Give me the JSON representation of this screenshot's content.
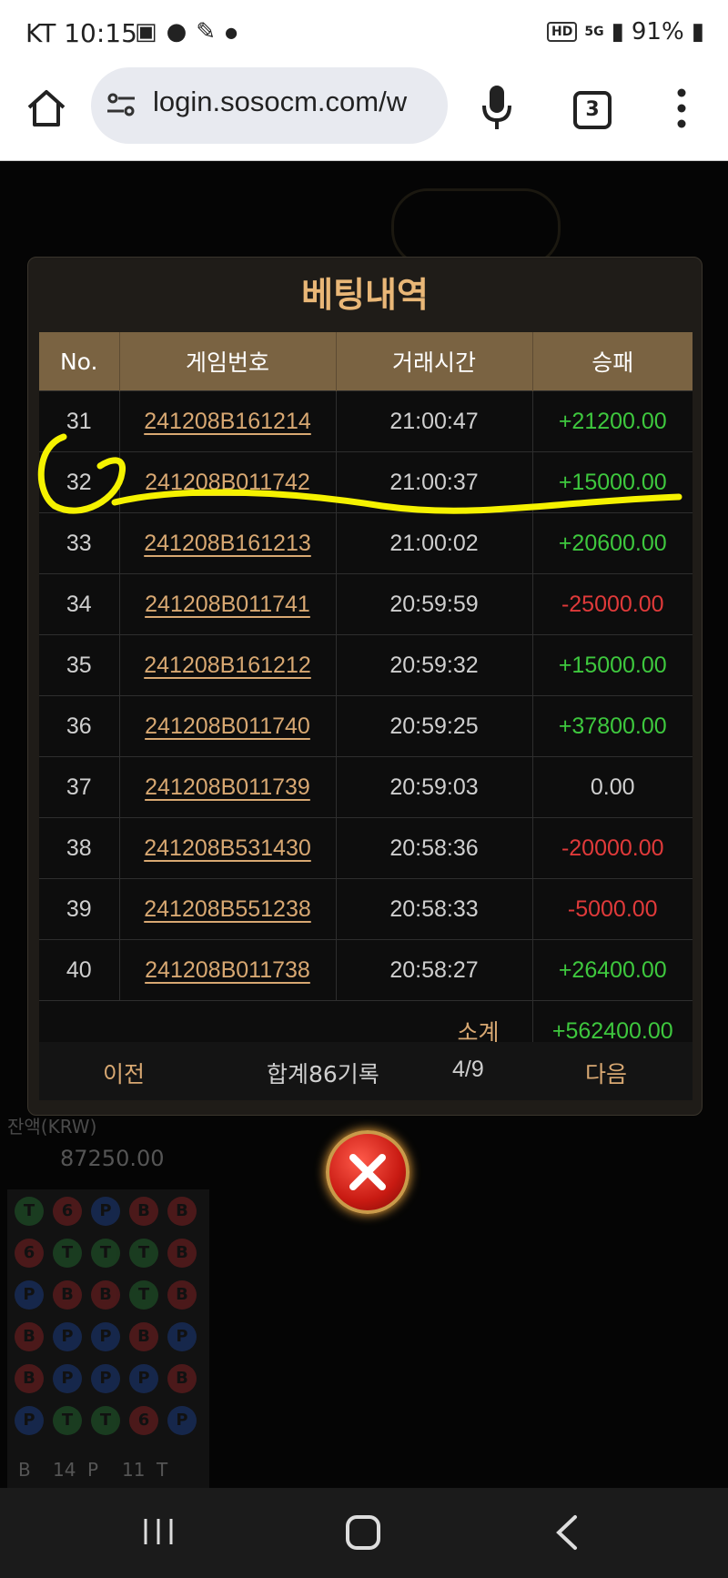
{
  "status_bar": {
    "carrier_time": "KT 10:15",
    "network": "5G",
    "battery": "91%"
  },
  "browser": {
    "url": "login.sosocm.com/w",
    "tab_count": "3"
  },
  "modal": {
    "title": "베팅내역",
    "columns": [
      "No.",
      "게임번호",
      "거래시간",
      "승패"
    ],
    "rows": [
      {
        "no": "31",
        "game": "241208B161214",
        "time": "21:00:47",
        "result": "+21200.00",
        "sign": "pos"
      },
      {
        "no": "32",
        "game": "241208B011742",
        "time": "21:00:37",
        "result": "+15000.00",
        "sign": "pos"
      },
      {
        "no": "33",
        "game": "241208B161213",
        "time": "21:00:02",
        "result": "+20600.00",
        "sign": "pos"
      },
      {
        "no": "34",
        "game": "241208B011741",
        "time": "20:59:59",
        "result": "-25000.00",
        "sign": "neg"
      },
      {
        "no": "35",
        "game": "241208B161212",
        "time": "20:59:32",
        "result": "+15000.00",
        "sign": "pos"
      },
      {
        "no": "36",
        "game": "241208B011740",
        "time": "20:59:25",
        "result": "+37800.00",
        "sign": "pos"
      },
      {
        "no": "37",
        "game": "241208B011739",
        "time": "20:59:03",
        "result": "0.00",
        "sign": "zero"
      },
      {
        "no": "38",
        "game": "241208B531430",
        "time": "20:58:36",
        "result": "-20000.00",
        "sign": "neg"
      },
      {
        "no": "39",
        "game": "241208B551238",
        "time": "20:58:33",
        "result": "-5000.00",
        "sign": "neg"
      },
      {
        "no": "40",
        "game": "241208B011738",
        "time": "20:58:27",
        "result": "+26400.00",
        "sign": "pos"
      }
    ],
    "subtotal_label": "소계",
    "subtotal_value": "+562400.00",
    "pager": {
      "prev": "이전",
      "total": "합계86기록",
      "page": "4/9",
      "next": "다음"
    }
  },
  "background": {
    "balance_label": "잔액(KRW)",
    "balance": "87250.00",
    "road_labels": [
      "T",
      "6",
      "P",
      "B",
      "B",
      "6",
      "T",
      "T",
      "T",
      "B",
      "P",
      "B",
      "B",
      "T",
      "B",
      "B",
      "P",
      "P",
      "B",
      "P",
      "B",
      "P",
      "P",
      "P",
      "B",
      "P",
      "T",
      "T",
      "6",
      "P"
    ],
    "counts": [
      "B",
      "14",
      "P",
      "11",
      "T"
    ]
  },
  "colors": {
    "accent_gold": "#e9b777",
    "header_bg": "#7a6342",
    "win_green": "#3ec83e",
    "loss_red": "#e03a3a",
    "highlight_yellow": "#f5f200"
  }
}
